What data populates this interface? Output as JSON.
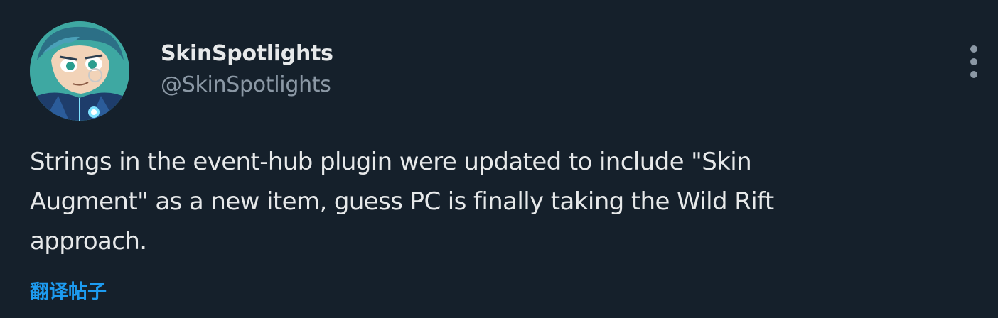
{
  "author": {
    "display_name": "SkinSpotlights",
    "handle": "@SkinSpotlights",
    "avatar_icon": "avatar-cartoon-character"
  },
  "tweet": {
    "text_lines": [
      "Strings in the event-hub plugin were updated to include \"Skin",
      "Augment\" as a new item, guess PC is finally taking the Wild Rift",
      "approach."
    ]
  },
  "actions": {
    "translate_label": "翻译帖子",
    "more_icon": "more-vertical-icon"
  },
  "colors": {
    "background": "#15202b",
    "primary_text": "#e7e9ea",
    "secondary_text": "#8b98a5",
    "accent": "#1d9bf0"
  }
}
